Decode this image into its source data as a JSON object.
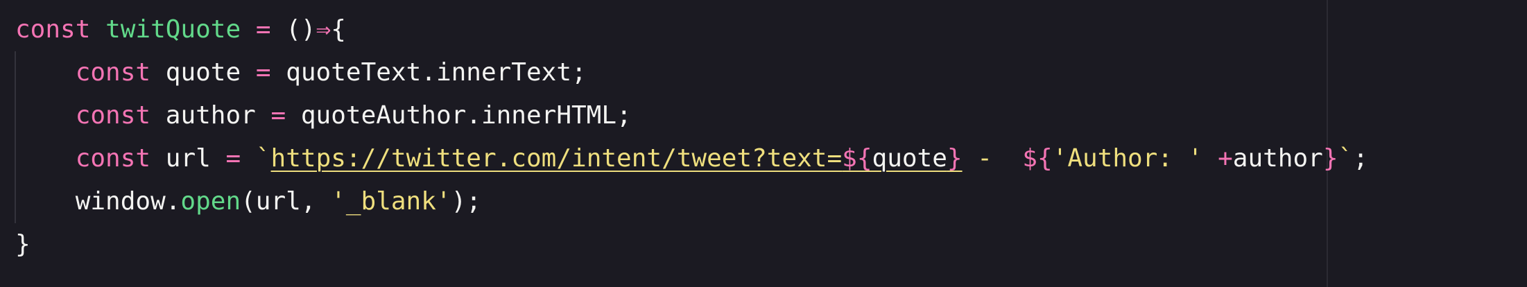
{
  "code": {
    "line1": {
      "kw": "const",
      "sp1": " ",
      "fn_name": "twitQuote",
      "sp2": " ",
      "eq": "=",
      "sp3": " ",
      "parens": "()",
      "arrow": "⇒",
      "brace": "{"
    },
    "line2": {
      "indent": "    ",
      "kw": "const",
      "sp1": " ",
      "var": "quote",
      "sp2": " ",
      "eq": "=",
      "sp3": " ",
      "value": "quoteText.innerText;"
    },
    "line3": {
      "indent": "    ",
      "kw": "const",
      "sp1": " ",
      "var": "author",
      "sp2": " ",
      "eq": "=",
      "sp3": " ",
      "value": "quoteAuthor.innerHTML;"
    },
    "line4": {
      "indent": "    ",
      "kw": "const",
      "sp1": " ",
      "var": "url",
      "sp2": " ",
      "eq": "=",
      "sp3": " ",
      "backtick_open": "`",
      "url_text": "https://twitter.com/intent/tweet?text=",
      "interp1_open": "${",
      "interp1_var": "quote",
      "interp1_close": "}",
      "dash": " -  ",
      "interp2_open": "${",
      "author_str": "'Author: '",
      "sp4": " ",
      "plus": "+",
      "interp2_var": "author",
      "interp2_close": "}",
      "backtick_close": "`",
      "semicolon": ";"
    },
    "line5": {
      "indent": "    ",
      "object": "window.",
      "method": "open",
      "args_open": "(url, ",
      "arg_str": "'_blank'",
      "args_close": ");"
    },
    "line6": {
      "brace": "}"
    }
  },
  "colors": {
    "background": "#1b1a22",
    "keyword": "#f474b4",
    "function": "#62d98a",
    "string": "#efdf7e",
    "text": "#f4f4f2"
  }
}
